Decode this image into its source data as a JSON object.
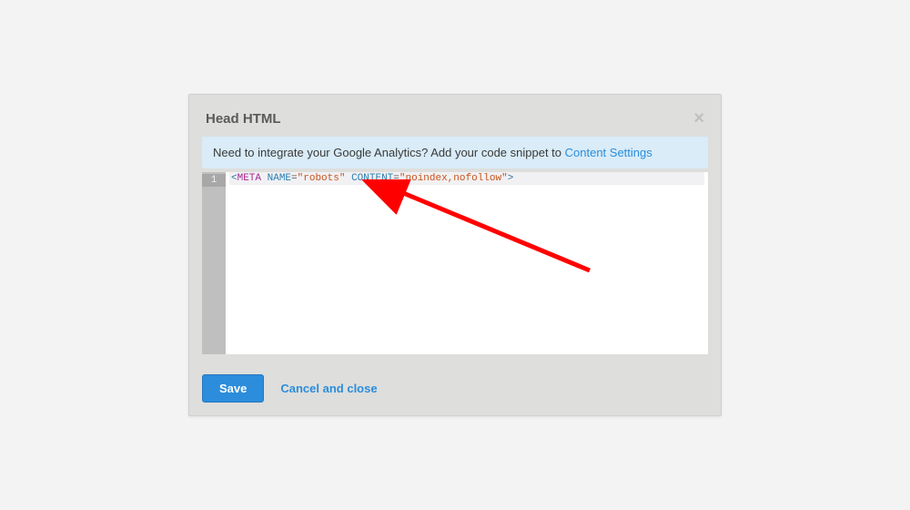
{
  "modal": {
    "title": "Head HTML",
    "close_glyph": "×"
  },
  "info": {
    "text_prefix": "Need to integrate your Google Analytics? Add your code snippet to ",
    "link_text": "Content Settings"
  },
  "editor": {
    "line_number": "1",
    "code": {
      "open_bracket": "<",
      "tag": "META",
      "sp1": " ",
      "attr1": "NAME",
      "eq1": "=",
      "val1": "\"robots\"",
      "sp2": " ",
      "attr2": "CONTENT",
      "eq2": "=",
      "val2": "\"noindex,nofollow\"",
      "close_bracket": ">"
    }
  },
  "footer": {
    "save_label": "Save",
    "cancel_label": "Cancel and close"
  },
  "annotation": {
    "arrow_color": "#ff0000"
  }
}
